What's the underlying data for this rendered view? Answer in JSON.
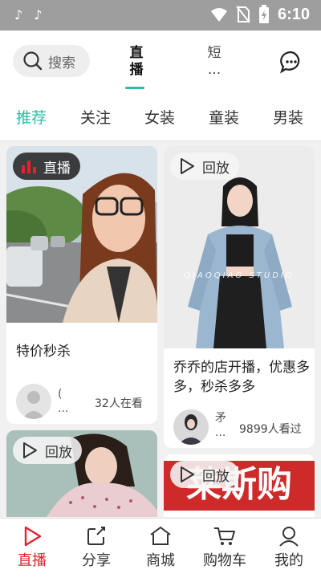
{
  "status_bar": {
    "time": "6:10",
    "notif_icons": [
      "tiktok-icon",
      "tiktok-icon"
    ]
  },
  "header": {
    "search_label": "搜索",
    "tabs": [
      {
        "label_line1": "直",
        "label_line2": "播",
        "active": true
      },
      {
        "label_line1": "短",
        "label_line2": "...",
        "active": false
      }
    ]
  },
  "categories": [
    {
      "label": "推荐",
      "active": true
    },
    {
      "label": "关注",
      "active": false
    },
    {
      "label": "女装",
      "active": false
    },
    {
      "label": "童装",
      "active": false
    },
    {
      "label": "男装",
      "active": false
    }
  ],
  "feed": {
    "card1": {
      "badge": "直播",
      "title": "特价秒杀",
      "shop_line1": "(",
      "shop_line2": "...",
      "viewers": "32人在看"
    },
    "card2": {
      "badge": "回放",
      "title": "乔乔的店开播，优惠多多，秒杀多多",
      "watermark": "QIAOQIAO STUDIO",
      "shop_line1": "矛",
      "shop_line2": "...",
      "viewers": "9899人看过"
    },
    "card3": {
      "badge": "回放"
    },
    "card4": {
      "badge": "回放",
      "banner_text": "莱斯购"
    }
  },
  "bottom_nav": [
    {
      "label": "直播",
      "icon": "live-icon",
      "active": true
    },
    {
      "label": "分享",
      "icon": "share-icon",
      "active": false
    },
    {
      "label": "商城",
      "icon": "mall-icon",
      "active": false
    },
    {
      "label": "购物车",
      "icon": "cart-icon",
      "active": false
    },
    {
      "label": "我的",
      "icon": "profile-icon",
      "active": false
    }
  ],
  "colors": {
    "accent": "#2fbba5",
    "nav_active": "#e5212f",
    "status_bar": "#9e9e9e"
  }
}
